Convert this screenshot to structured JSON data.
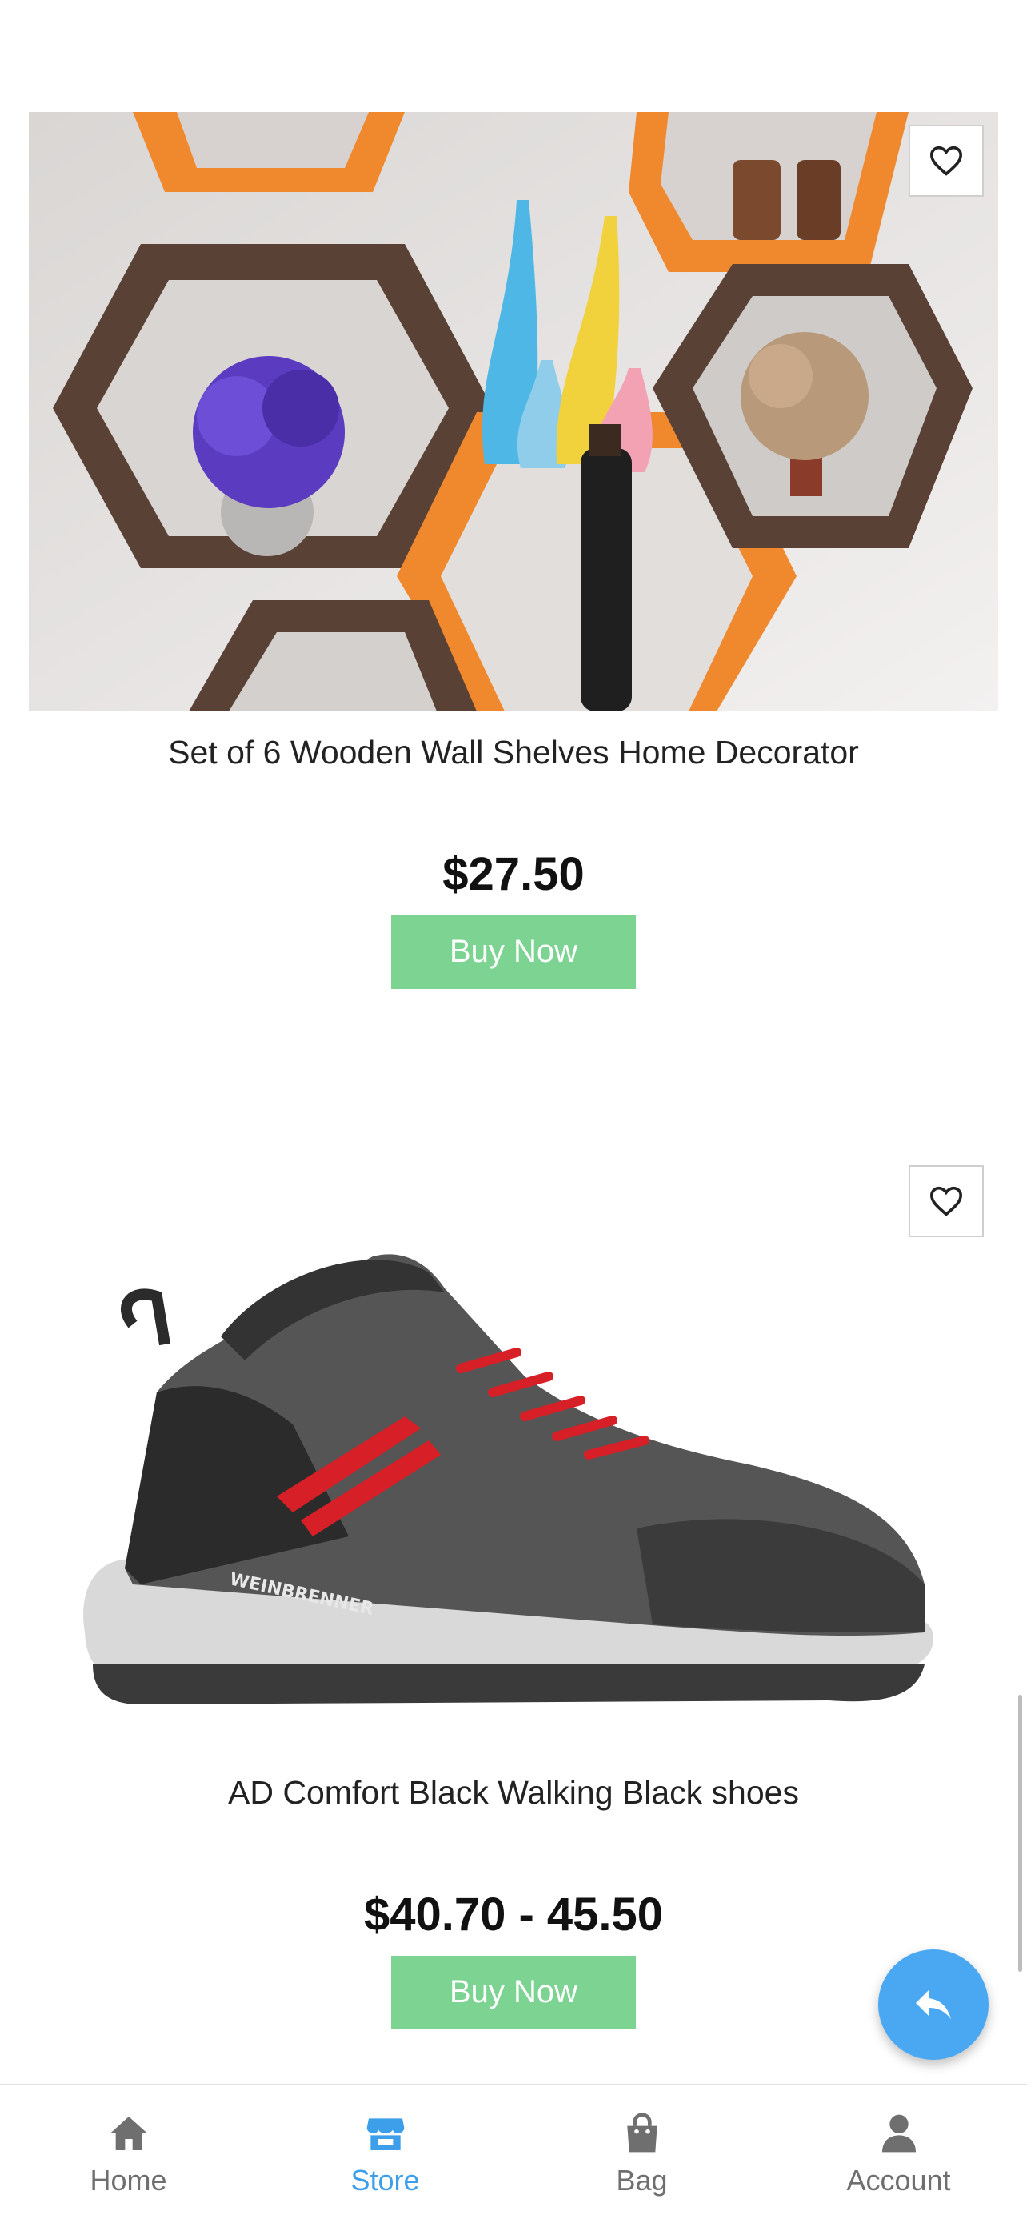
{
  "products": [
    {
      "title": "Set of 6 Wooden Wall Shelves Home Decorator",
      "price": "$27.50",
      "buy_label": "Buy Now"
    },
    {
      "title": "AD Comfort Black Walking Black shoes",
      "price": "$40.70 - 45.50",
      "buy_label": "Buy Now",
      "shoe_brand": "WEINBRENNER"
    }
  ],
  "bottom_nav": {
    "items": [
      {
        "label": "Home",
        "icon": "home-icon"
      },
      {
        "label": "Store",
        "icon": "store-icon",
        "active": true
      },
      {
        "label": "Bag",
        "icon": "bag-icon"
      },
      {
        "label": "Account",
        "icon": "account-icon"
      }
    ]
  },
  "colors": {
    "accent": "#3d9fea",
    "buy_button": "#7dd391",
    "fab": "#4aa8f2"
  }
}
